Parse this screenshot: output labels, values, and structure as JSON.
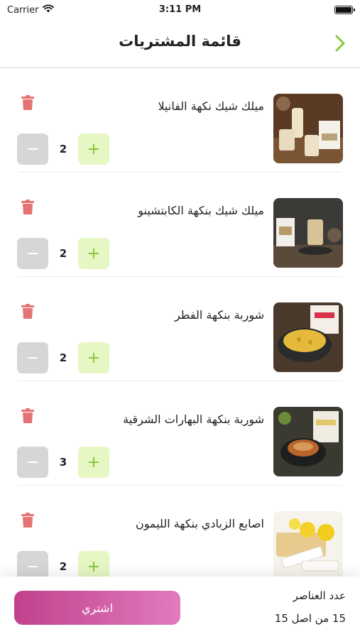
{
  "status_bar": {
    "carrier": "Carrier",
    "time": "3:11 PM"
  },
  "header": {
    "title": "قائمة المشتريات"
  },
  "items": [
    {
      "name": "ميلك شيك نكهة الفانيلا",
      "quantity": "2"
    },
    {
      "name": "ميلك شيك بنكهة الكابتشينو",
      "quantity": "2"
    },
    {
      "name": "شوربة بنكهة الفطر",
      "quantity": "2"
    },
    {
      "name": "شوربة بنكهة البهارات الشرقية",
      "quantity": "3"
    },
    {
      "name": "اصابع الزبادي بنكهة الليمون",
      "quantity": "2"
    }
  ],
  "footer": {
    "buy_label": "اشتري",
    "count_label": "عدد العناصر",
    "count_value": "15 من اصل 15"
  },
  "colors": {
    "accent_green": "#8cc63f",
    "plus_bg": "#e6f7c4",
    "minus_bg": "#d6d6d6",
    "trash_red": "#e57373",
    "buy_gradient_start": "#c2418c",
    "buy_gradient_end": "#e07bbd"
  }
}
